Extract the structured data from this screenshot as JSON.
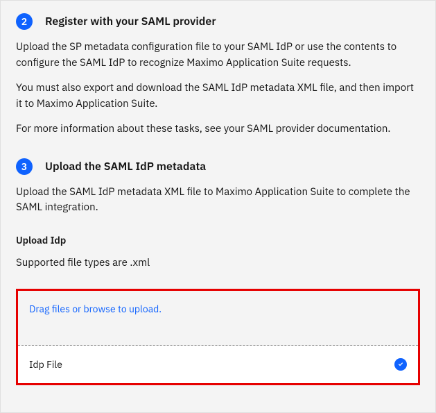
{
  "step2": {
    "number": "2",
    "title": "Register with your SAML provider",
    "para1": "Upload the SP metadata configuration file to your SAML IdP or use the contents to configure the SAML IdP to recognize Maximo Application Suite requests.",
    "para2": "You must also export and download the SAML IdP metadata XML file, and then import it to Maximo Application Suite.",
    "para3": "For more information about these tasks, see your SAML provider documentation."
  },
  "step3": {
    "number": "3",
    "title": "Upload the SAML IdP metadata",
    "para1": "Upload the SAML IdP metadata XML file to Maximo Application Suite to complete the SAML integration."
  },
  "upload": {
    "sectionLabel": "Upload Idp",
    "supported": "Supported file types are .xml",
    "dropText": "Drag files or browse to upload.",
    "fileName": "Idp File"
  }
}
